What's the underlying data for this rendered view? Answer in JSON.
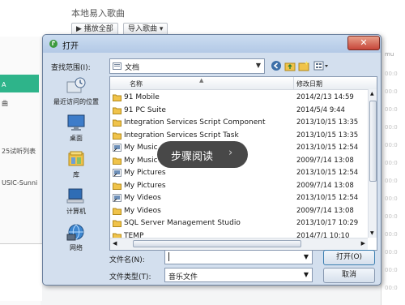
{
  "background_app": {
    "title": "本地易入歌曲",
    "play_all_label": "▶ 播放全部",
    "import_label": "导入歌曲 ▾",
    "left_texts": [
      "A",
      "曲",
      "25试听列表",
      "USIC-Sunni"
    ],
    "right_texts": [
      "mu",
      "00:0",
      "00:0",
      "00:0",
      "00:0",
      "00:0",
      "00:0",
      "00:0",
      "00:0",
      "00:0",
      "00:0",
      "00:0",
      "00:0",
      "00:0"
    ],
    "accent_color": "#2eb48a"
  },
  "dialog": {
    "title": "打开",
    "close_label": "✕",
    "look_in_label": "查找范围(I):",
    "look_in_value": "文档",
    "places": [
      {
        "label": "最近访问的位置",
        "icon": "recent-places-icon"
      },
      {
        "label": "桌面",
        "icon": "desktop-icon"
      },
      {
        "label": "库",
        "icon": "libraries-icon"
      },
      {
        "label": "计算机",
        "icon": "computer-icon"
      },
      {
        "label": "网络",
        "icon": "network-icon"
      }
    ],
    "columns": {
      "name": "名称",
      "date": "修改日期"
    },
    "files": [
      {
        "name": "91 Mobile",
        "date": "2014/2/13 14:59",
        "icon": "folder"
      },
      {
        "name": "91 PC Suite",
        "date": "2014/5/4 9:44",
        "icon": "folder"
      },
      {
        "name": "Integration Services Script Component",
        "date": "2013/10/15 13:35",
        "icon": "folder"
      },
      {
        "name": "Integration Services Script Task",
        "date": "2013/10/15 13:35",
        "icon": "folder"
      },
      {
        "name": "My Music",
        "date": "2013/10/15 12:54",
        "icon": "shortcut"
      },
      {
        "name": "My Music",
        "date": "2009/7/14 13:08",
        "icon": "folder"
      },
      {
        "name": "My Pictures",
        "date": "2013/10/15 12:54",
        "icon": "shortcut"
      },
      {
        "name": "My Pictures",
        "date": "2009/7/14 13:08",
        "icon": "folder"
      },
      {
        "name": "My Videos",
        "date": "2013/10/15 12:54",
        "icon": "shortcut"
      },
      {
        "name": "My Videos",
        "date": "2009/7/14 13:08",
        "icon": "folder"
      },
      {
        "name": "SQL Server Management Studio",
        "date": "2013/10/17 10:29",
        "icon": "folder"
      },
      {
        "name": "TEMP",
        "date": "2014/7/1 10:10",
        "icon": "folder"
      }
    ],
    "file_name_label": "文件名(N):",
    "file_name_value": "",
    "file_type_label": "文件类型(T):",
    "file_type_value": "音乐文件",
    "open_label": "打开(O)",
    "cancel_label": "取消"
  },
  "overlay": {
    "label": "步骤阅读",
    "chevron": "›"
  }
}
